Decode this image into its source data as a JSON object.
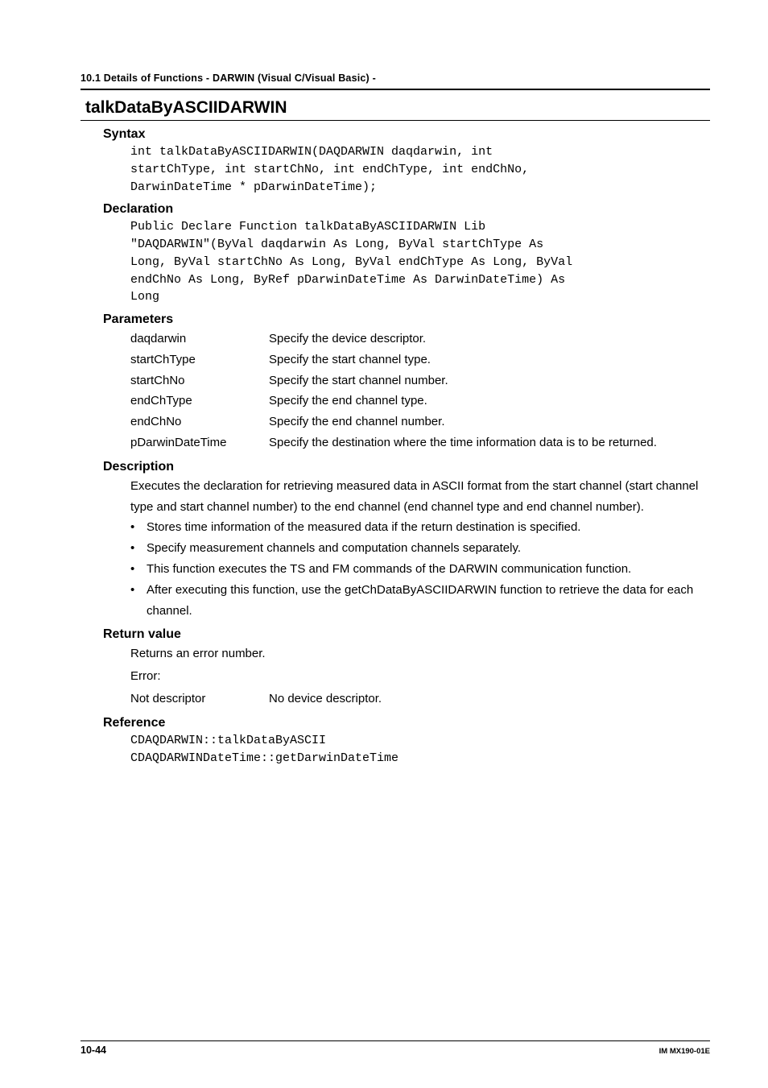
{
  "header": {
    "section": "10.1  Details of Functions - DARWIN (Visual C/Visual   Basic) -"
  },
  "function_name": "talkDataByASCIIDARWIN",
  "sections": {
    "syntax_label": "Syntax",
    "syntax_code": "int talkDataByASCIIDARWIN(DAQDARWIN daqdarwin, int\nstartChType, int startChNo, int endChType, int endChNo,\nDarwinDateTime * pDarwinDateTime);",
    "declaration_label": "Declaration",
    "declaration_code": "Public Declare Function talkDataByASCIIDARWIN Lib\n\"DAQDARWIN\"(ByVal daqdarwin As Long, ByVal startChType As\nLong, ByVal startChNo As Long, ByVal endChType As Long, ByVal\nendChNo As Long, ByRef pDarwinDateTime As DarwinDateTime) As\nLong",
    "parameters_label": "Parameters",
    "parameters": [
      {
        "name": "daqdarwin",
        "desc": "Specify the device descriptor."
      },
      {
        "name": "startChType",
        "desc": "Specify the start channel type."
      },
      {
        "name": "startChNo",
        "desc": "Specify the start channel number."
      },
      {
        "name": "endChType",
        "desc": "Specify the end channel type."
      },
      {
        "name": "endChNo",
        "desc": "Specify the end channel number."
      },
      {
        "name": "pDarwinDateTime",
        "desc": "Specify the destination where the time information data is to be returned."
      }
    ],
    "description_label": "Description",
    "description_intro": "Executes the declaration for retrieving measured data in ASCII format from the start channel (start channel type and start channel number) to the end channel (end channel type and end channel number).",
    "description_bullets": [
      "Stores time information of the measured data if the return destination is specified.",
      " Specify measurement channels and computation channels separately.",
      " This function executes the TS and FM commands of the DARWIN communication function.",
      " After executing this function, use the getChDataByASCIIDARWIN function to retrieve the data for each channel."
    ],
    "return_label": "Return value",
    "return_line1": "Returns an error number.",
    "return_line2": "Error:",
    "return_error": {
      "name": "Not descriptor",
      "desc": "No device descriptor."
    },
    "reference_label": "Reference",
    "reference_code": "CDAQDARWIN::talkDataByASCII\nCDAQDARWINDateTime::getDarwinDateTime"
  },
  "footer": {
    "page": "10-44",
    "docid": "IM MX190-01E"
  }
}
